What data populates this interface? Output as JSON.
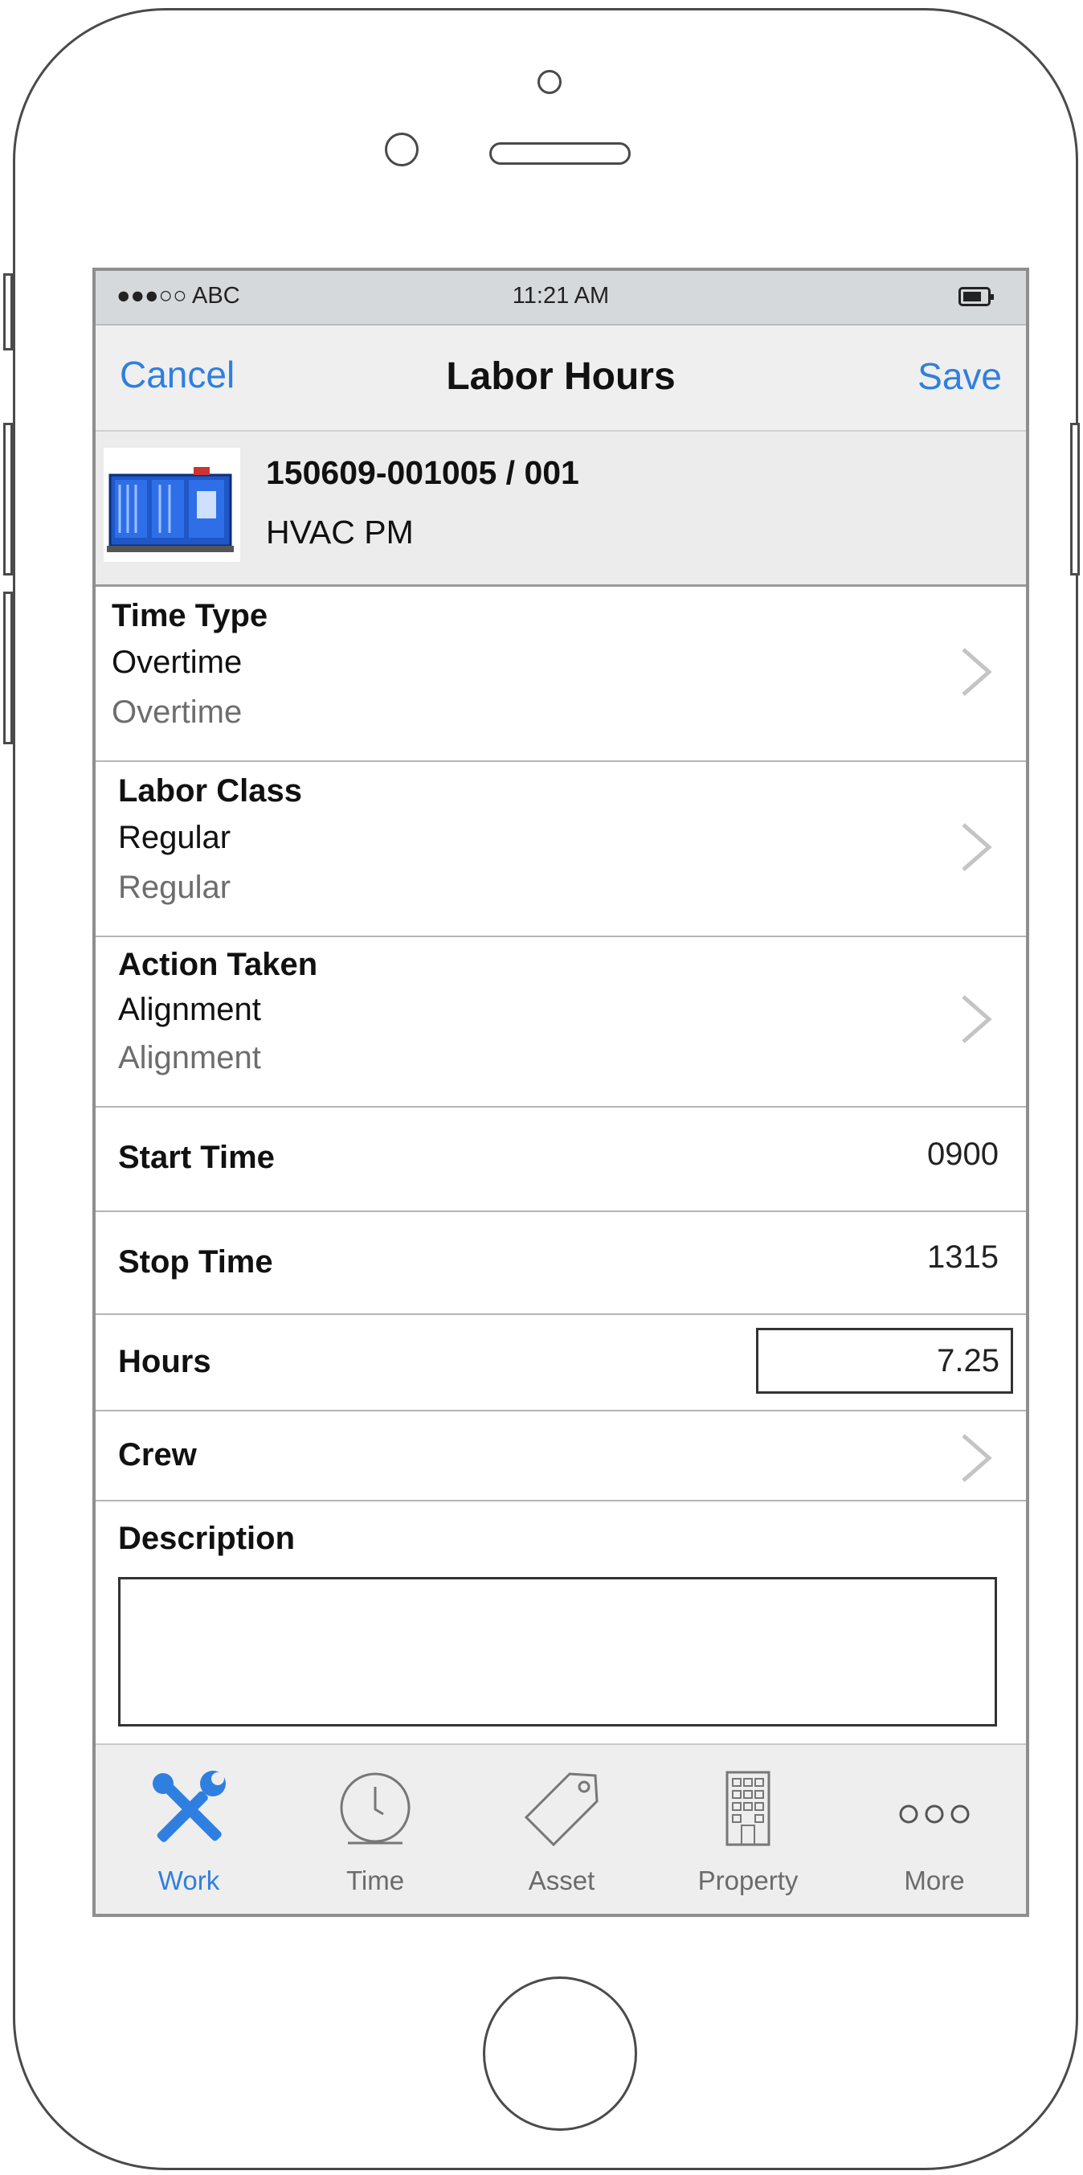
{
  "status_bar": {
    "carrier": "●●●○○ ABC",
    "time": "11:21 AM",
    "battery_icon": "battery-icon"
  },
  "nav": {
    "cancel_label": "Cancel",
    "title": "Labor Hours",
    "save_label": "Save"
  },
  "work_order": {
    "number": "150609-001005 / 001",
    "description": "HVAC PM",
    "image_icon": "hvac-unit-thumbnail"
  },
  "fields": {
    "time_type": {
      "label": "Time Type",
      "value": "Overtime",
      "secondary": "Overtime"
    },
    "labor_class": {
      "label": "Labor Class",
      "value": "Regular",
      "secondary": "Regular"
    },
    "action_taken": {
      "label": "Action Taken",
      "value": "Alignment",
      "secondary": "Alignment"
    },
    "start_time": {
      "label": "Start Time",
      "value": "0900"
    },
    "stop_time": {
      "label": "Stop Time",
      "value": "1315"
    },
    "hours": {
      "label": "Hours",
      "value": "7.25"
    },
    "crew": {
      "label": "Crew"
    },
    "description": {
      "label": "Description",
      "value": ""
    }
  },
  "tabs": [
    {
      "label": "Work",
      "icon": "tools-icon",
      "active": true
    },
    {
      "label": "Time",
      "icon": "clock-icon",
      "active": false
    },
    {
      "label": "Asset",
      "icon": "tag-icon",
      "active": false
    },
    {
      "label": "Property",
      "icon": "building-icon",
      "active": false
    },
    {
      "label": "More",
      "icon": "more-icon",
      "active": false
    }
  ],
  "colors": {
    "accent": "#2f7fe0",
    "nav_bg": "#efefef",
    "status_bg": "#d6d9dc",
    "header_bg": "#ececec"
  }
}
